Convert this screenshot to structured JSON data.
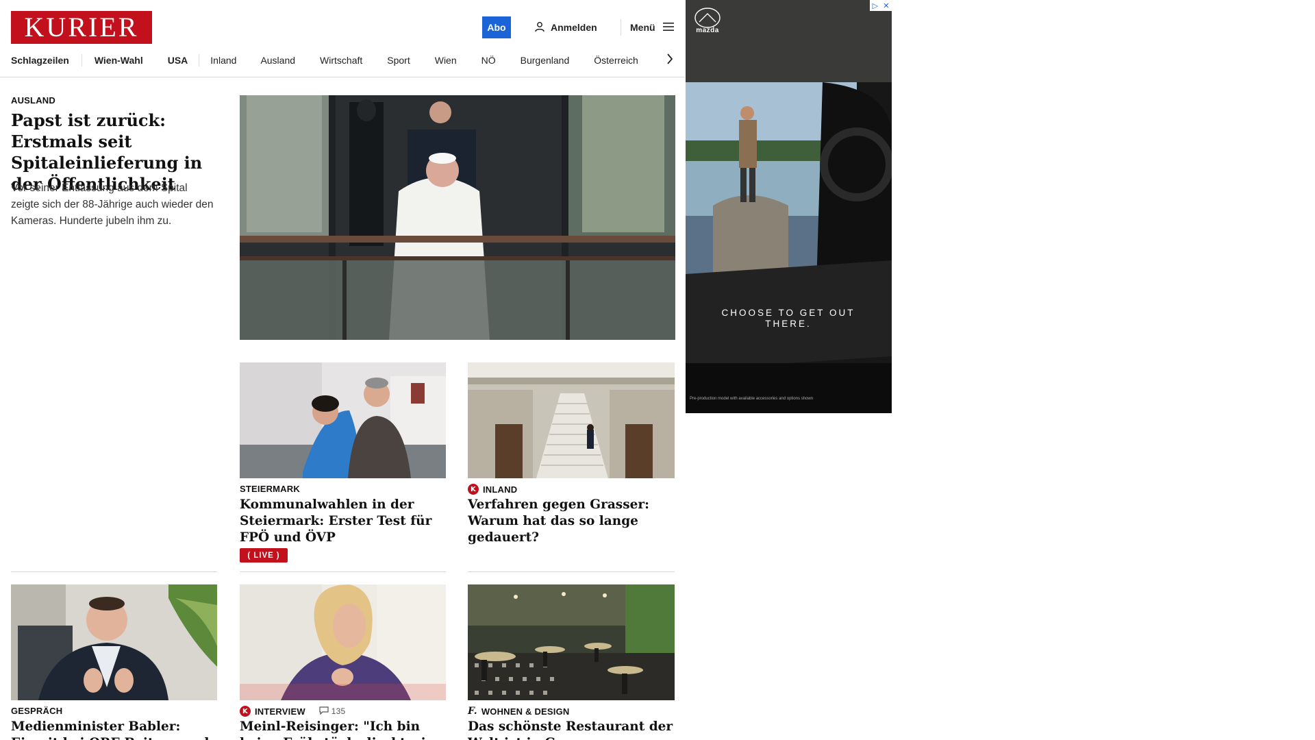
{
  "header": {
    "logo_text": "KURIER",
    "abo_label": "Abo",
    "login_label": "Anmelden",
    "menu_label": "Menü"
  },
  "nav": {
    "items": [
      "Schlagzeilen",
      "Wien-Wahl",
      "USA",
      "Inland",
      "Ausland",
      "Wirtschaft",
      "Sport",
      "Wien",
      "NÖ",
      "Burgenland",
      "Österreich"
    ]
  },
  "lead": {
    "kicker": "AUSLAND",
    "title": "Papst ist zurück: Erstmals seit Spitaleinlieferung in der Öffentlichkeit",
    "teaser": "Vor seiner Entlassung aus dem Spital zeigte sich der 88-Jährige auch wieder den Kameras. Hunderte jubeln ihm zu."
  },
  "cards": [
    {
      "kicker": "STEIERMARK",
      "title": "Kommunalwahlen in der Steiermark: Erster Test für FPÖ und ÖVP",
      "live_label": "LIVE"
    },
    {
      "kicker": "INLAND",
      "title": "Verfahren gegen Grasser: Warum hat das so lange gedauert?",
      "badge": "K"
    },
    {
      "kicker": "GESPRÄCH",
      "title": "Medienminister Babler: Eiszeit bei ORF-Beitrag und"
    },
    {
      "kicker": "INTERVIEW",
      "title": "Meinl-Reisinger: \"Ich bin keine Frühstücksdirektorin, sondern",
      "badge": "K",
      "comments": "135"
    },
    {
      "kicker": "WOHNEN & DESIGN",
      "title": "Das schönste Restaurant der Welt ist in Graz",
      "badge": "f."
    }
  ],
  "ad": {
    "brand": "mazda",
    "headline": "CHOOSE TO GET OUT THERE.",
    "disclaimer": "Pre-production model with available accessories and options shown",
    "adchoices": "▷",
    "close": "✕"
  },
  "colors": {
    "brand_red": "#c3101d",
    "abo_blue": "#1b64d8"
  }
}
